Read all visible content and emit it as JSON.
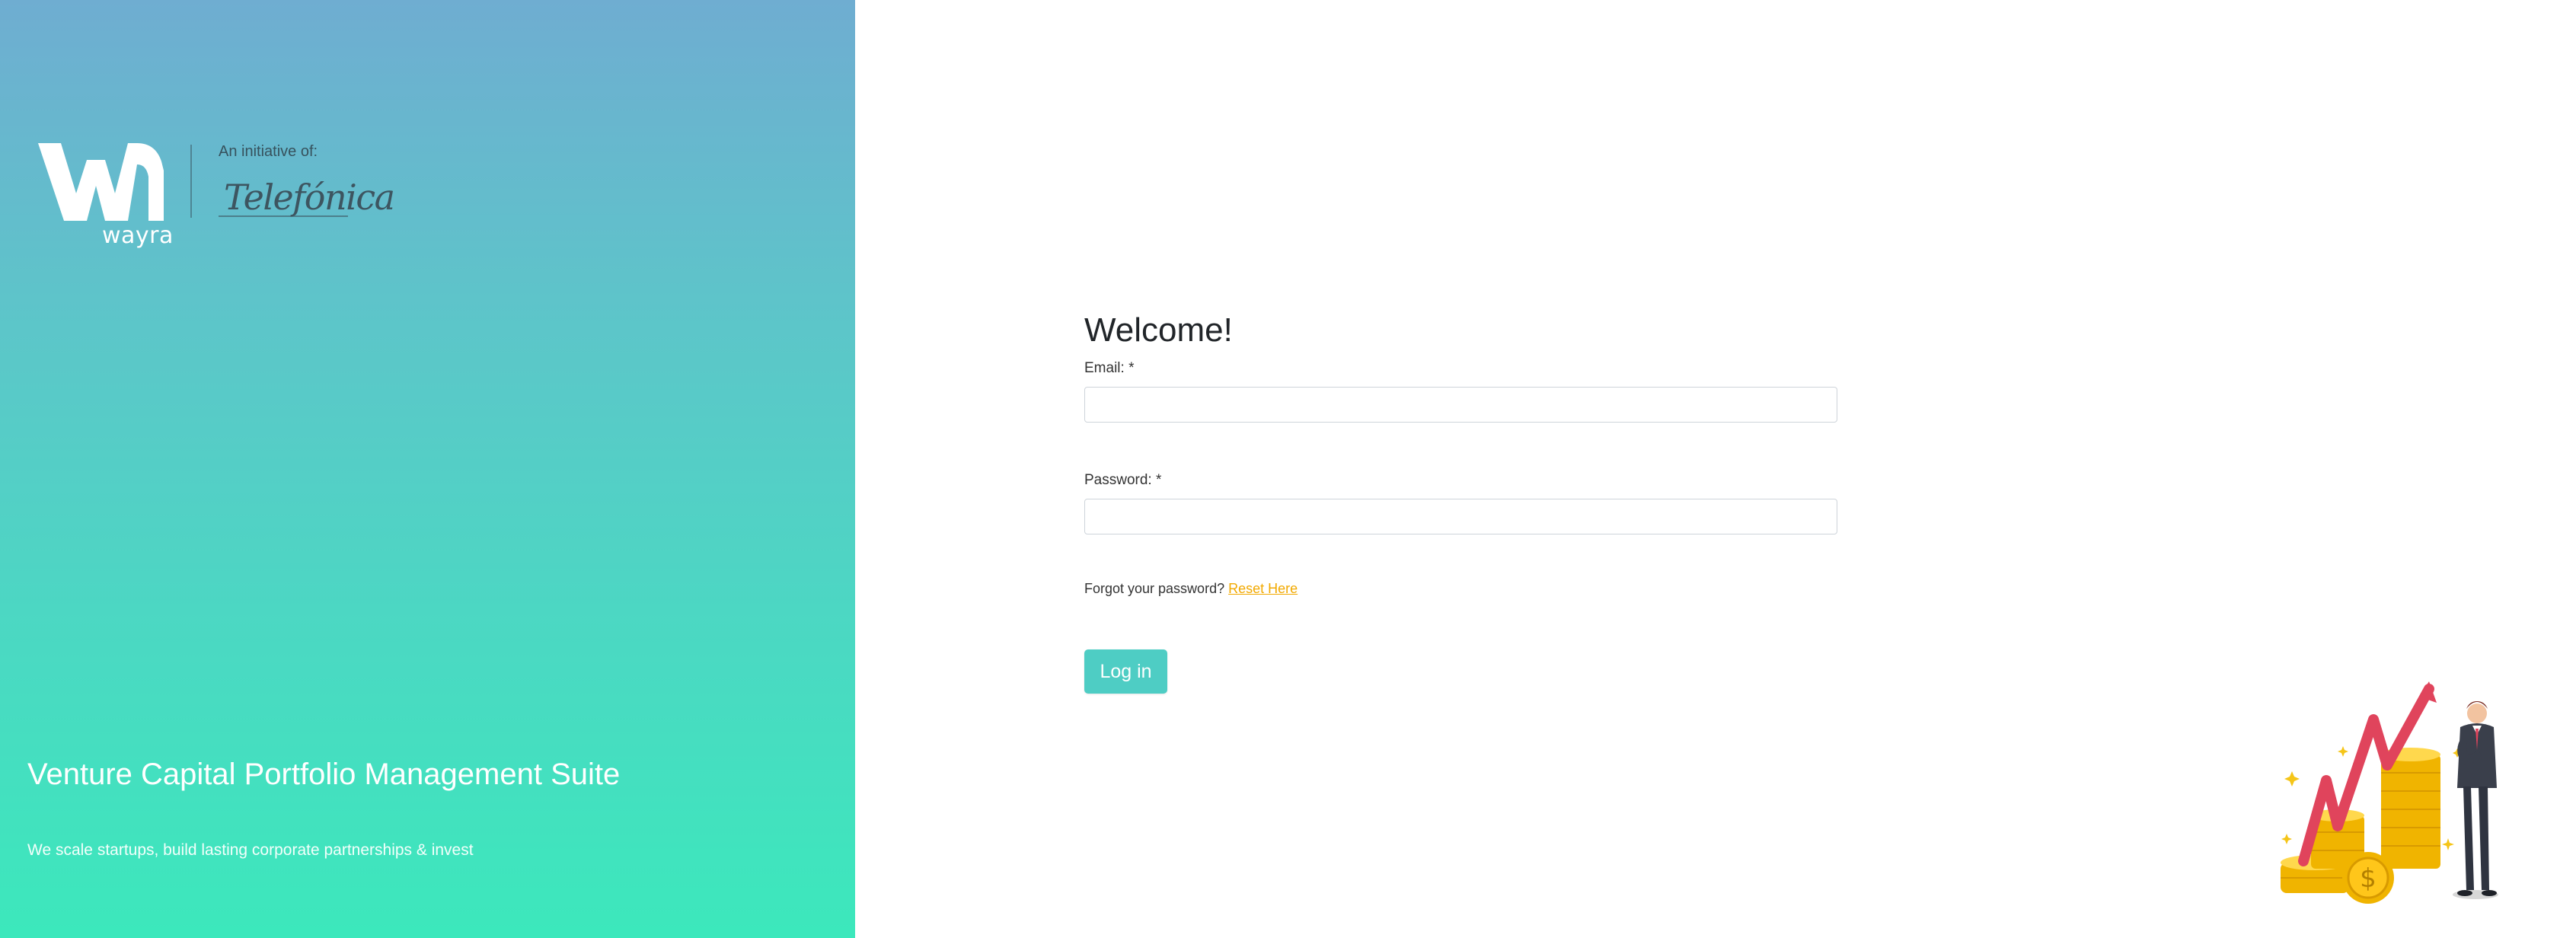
{
  "brand": {
    "logo_word": "wayra",
    "initiative_label": "An initiative of:",
    "partner_logo": "Telefónica"
  },
  "hero": {
    "title": "Venture Capital Portfolio Management Suite",
    "subtitle": "We scale startups, build lasting corporate partnerships & invest"
  },
  "login": {
    "heading": "Welcome!",
    "email_label": "Email: *",
    "email_value": "",
    "password_label": "Password: *",
    "password_value": "",
    "forgot_text": "Forgot your password?",
    "reset_link": "Reset Here",
    "submit_label": "Log in"
  },
  "colors": {
    "gradient_top": "#6fadd1",
    "gradient_bottom": "#3ce8bc",
    "button": "#4ecdc4",
    "link": "#f2a900",
    "heading_text": "#212529"
  },
  "icons": {
    "brand_mark": "wayra-wm-logo",
    "illustration": "coins-growth-businessman-illustration"
  }
}
